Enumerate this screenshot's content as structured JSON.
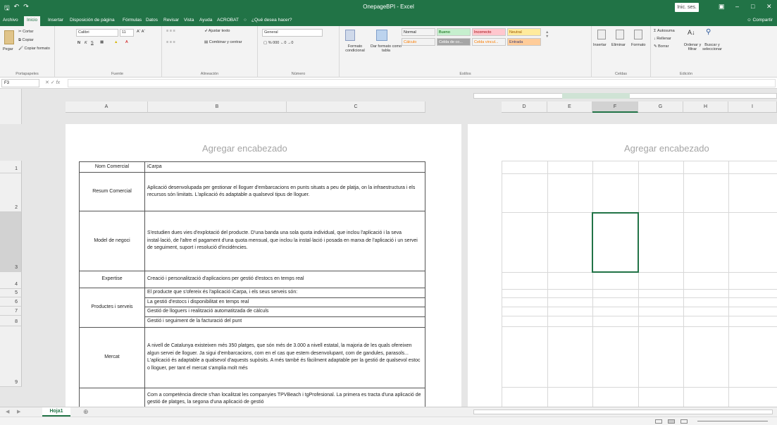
{
  "titlebar": {
    "window_title": "OnepageBPI - Excel",
    "user_label": "Inic. ses.",
    "minimize": "–",
    "maximize": "□",
    "close": "✕"
  },
  "menu": {
    "tabs": [
      "Archivo",
      "Inicio",
      "Insertar",
      "Disposición de página",
      "Fórmulas",
      "Datos",
      "Revisar",
      "Vista",
      "Ayuda",
      "ACROBAT"
    ],
    "tell_me": "¿Qué desea hacer?",
    "share": "Compartir"
  },
  "ribbon": {
    "clipboard": {
      "cut": "Cortar",
      "copy": "Copiar",
      "format": "Copiar formato",
      "paste": "Pegar",
      "label": "Portapapeles"
    },
    "font": {
      "name": "Calibri",
      "size": "11",
      "bold": "N",
      "italic": "K",
      "underline": "S",
      "label": "Fuente"
    },
    "alignment": {
      "wrap": "Ajustar texto",
      "merge": "Combinar y centrar",
      "label": "Alineación"
    },
    "number": {
      "format": "General",
      "label": "Número"
    },
    "styles": {
      "conditional": "Formato condicional",
      "table": "Dar formato como tabla",
      "cells": [
        {
          "text": "Normal",
          "bg": "#ffffff",
          "fg": "#000000"
        },
        {
          "text": "Bueno",
          "bg": "#c6efce",
          "fg": "#006100"
        },
        {
          "text": "Incorrecto",
          "bg": "#ffc7ce",
          "fg": "#9c0006"
        },
        {
          "text": "Neutral",
          "bg": "#ffeb9c",
          "fg": "#9c5700"
        },
        {
          "text": "Cálculo",
          "bg": "#f2f2f2",
          "fg": "#fa7d00"
        },
        {
          "text": "Celda de co...",
          "bg": "#a5a5a5",
          "fg": "#ffffff"
        },
        {
          "text": "Celda vincul...",
          "bg": "#ffffff",
          "fg": "#fa7d00"
        },
        {
          "text": "Entrada",
          "bg": "#ffcc99",
          "fg": "#3f3f76"
        }
      ],
      "label": "Estilos"
    },
    "cells": {
      "insert": "Insertar",
      "delete": "Eliminar",
      "format": "Formato",
      "label": "Celdas"
    },
    "editing": {
      "autosum": "Autosuma",
      "fill": "Rellenar",
      "clear": "Borrar",
      "sort": "Ordenar y filtrar",
      "find": "Buscar y seleccionar",
      "label": "Edición"
    }
  },
  "formula_bar": {
    "name_box": "F3",
    "fx": "fx",
    "value": ""
  },
  "columns_left": [
    "A",
    "B",
    "C"
  ],
  "columns_right": [
    "D",
    "E",
    "F",
    "G",
    "H",
    "I"
  ],
  "rows": [
    "1",
    "2",
    "3",
    "4",
    "5",
    "6",
    "7",
    "8",
    "9"
  ],
  "page_header": "Agregar encabezado",
  "document": [
    {
      "key": "Nom Comercial",
      "values": [
        "iCarpa"
      ]
    },
    {
      "key": "Resum Comercial",
      "values": [
        "Aplicació desenvolupada per gestionar el lloguer d'embarcacions en punts situats a peu de platja, on la infraestructura i els recursos són limitats. L'aplicació és adaptable a qualsevol tipus de lloguer."
      ]
    },
    {
      "key": "Model de negoci",
      "values": [
        "S'estudien dues vies d'explotació del producte. D'una banda una sola quota individual, que inclou l'aplicació i la seva instal·lació, de l'altre el pagament d'una quota mensual, que inclou la instal·lació i posada en marxa de l'aplicació i un servei de seguiment, suport i resolució d'incidències."
      ]
    },
    {
      "key": "Expertise",
      "values": [
        "Creació i personalització d'aplicacions per gestió d'estocs en temps real"
      ]
    },
    {
      "key": "Productes i serveis",
      "values": [
        "El producte que s'ofereix és l'aplicació iCarpa, i els seus serveis són:",
        "La gestió d'estocs i disponibilitat en temps real",
        "Gestió de lloguers i realització automatitzada de càlculs",
        "Gestió i seguiment de la facturació del punt"
      ]
    },
    {
      "key": "Mercat",
      "values": [
        "A nivell de Catalunya existeixen més 350 platges, que són més de 3.000 a nivell estatal, la majoria de les quals ofereixen algun servei de lloguer. Ja sigui d'embarcacions, com en el cas que estem desenvolupant, com de gandules, parasols... L'aplicació és adaptable a qualsevol d'aquests supòsits. A més també és fàcilment adaptable per la gestió de qualsevol estoc o lloguer, per tant el mercat s'amplia molt més"
      ]
    },
    {
      "key": "",
      "values": [
        "Com a competència directe s'han localitzat les companyies TPVBeach i tgProfesional. La primera es tracta d'una aplicació de gestió de platges, la segona d'una aplicació de gestió"
      ]
    }
  ],
  "sheet": {
    "tab": "Hoja1",
    "add": "⊕"
  }
}
